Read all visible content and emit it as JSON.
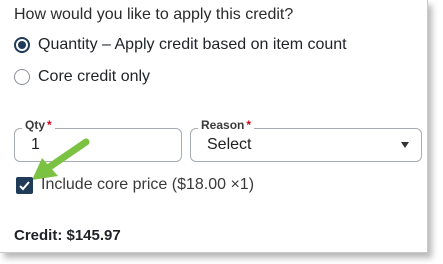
{
  "question": "How would you like to apply this credit?",
  "options": [
    {
      "label": "Quantity – Apply credit based on item count",
      "selected": true
    },
    {
      "label": "Core credit only",
      "selected": false
    }
  ],
  "qty": {
    "label": "Qty",
    "required_mark": "*",
    "value": "1"
  },
  "reason": {
    "label": "Reason",
    "required_mark": "*",
    "value": "Select"
  },
  "include_core": {
    "label": "Include core price ($18.00 ×1)",
    "checked": true
  },
  "credit_total": "Credit: $145.97",
  "colors": {
    "accent": "#1f3b57",
    "required": "#d0021b",
    "annotation_arrow": "#7cc242"
  },
  "icons": [
    "radio-selected-icon",
    "radio-unselected-icon",
    "chevron-down-icon",
    "checkmark-icon",
    "green-arrow-icon"
  ]
}
